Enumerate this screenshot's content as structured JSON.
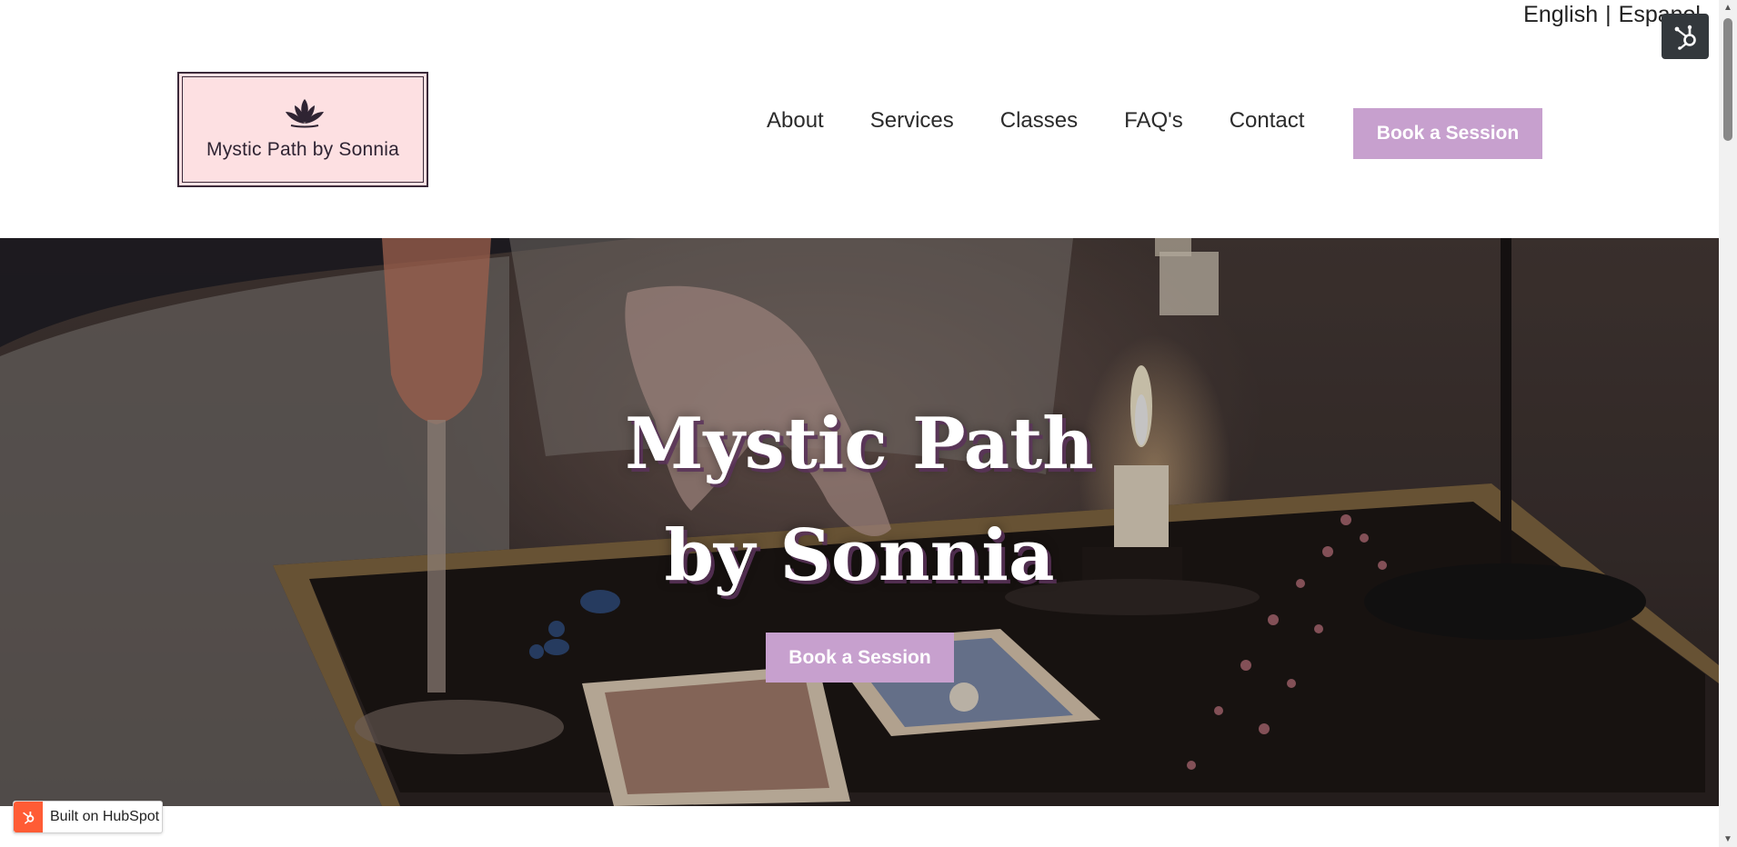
{
  "language_switcher": {
    "english": "English",
    "separator": "|",
    "espanol": "Espanol"
  },
  "header": {
    "logo_text": "Mystic Path by Sonnia",
    "nav": [
      {
        "label": "About"
      },
      {
        "label": "Services"
      },
      {
        "label": "Classes"
      },
      {
        "label": "FAQ's"
      },
      {
        "label": "Contact"
      }
    ],
    "cta_label": "Book a Session"
  },
  "hero": {
    "title_line1": "Mystic Path",
    "title_line2": "by Sonnia",
    "cta_label": "Book a Session"
  },
  "badge": {
    "text": "Built on HubSpot"
  },
  "colors": {
    "accent": "#c7a0ce",
    "logo_background": "#fde0e2",
    "hubspot_orange": "#ff5c35"
  },
  "icons": [
    "lotus-icon",
    "hubspot-sprocket-icon",
    "scroll-up-icon",
    "scroll-down-icon"
  ]
}
